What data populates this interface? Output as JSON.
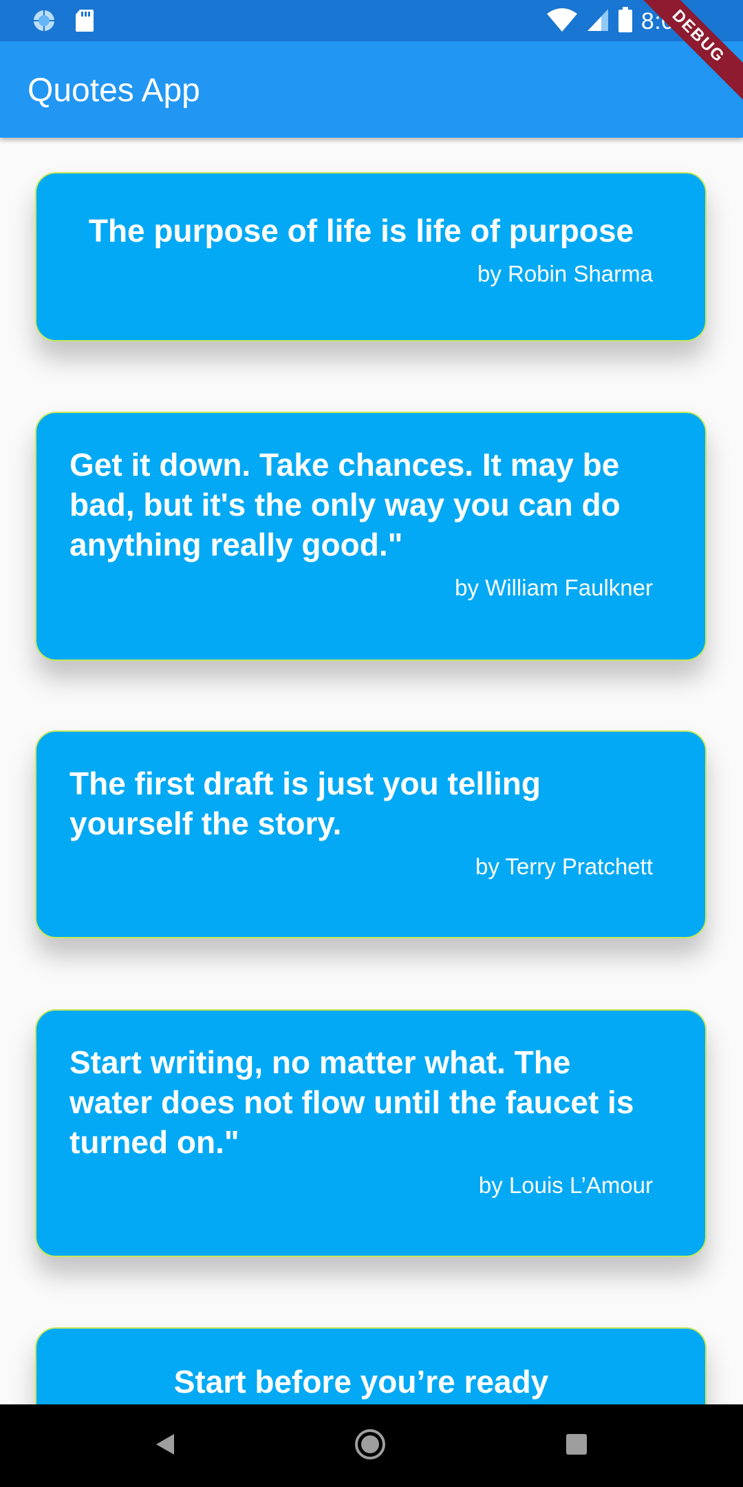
{
  "status_bar": {
    "time": "8:09",
    "debug_label": "DEBUG",
    "icons": [
      "sync-icon",
      "sd-card-icon",
      "wifi-icon",
      "signal-icon",
      "battery-icon"
    ]
  },
  "app_bar": {
    "title": "Quotes App"
  },
  "quotes": [
    {
      "text": "The purpose of life is life of purpose",
      "author": "by Robin Sharma"
    },
    {
      "text": "Get it down. Take chances. It may be bad, but it's the only way you can do anything really good.\"",
      "author": "by William Faulkner"
    },
    {
      "text": "The first draft is just you telling yourself the story.",
      "author": "by Terry Pratchett"
    },
    {
      "text": "Start writing, no matter what. The water does not flow until the faucet is turned on.\"",
      "author": "by Louis L’Amour"
    },
    {
      "text": "Start before you’re ready",
      "author": ""
    }
  ],
  "nav_bar": {
    "icons": [
      "back-icon",
      "home-icon",
      "recents-icon"
    ]
  },
  "colors": {
    "status_bar": "#1976d2",
    "app_bar": "#2196f3",
    "card": "#03a9f4",
    "card_border": "#c6e85a",
    "background": "#fafafa"
  }
}
